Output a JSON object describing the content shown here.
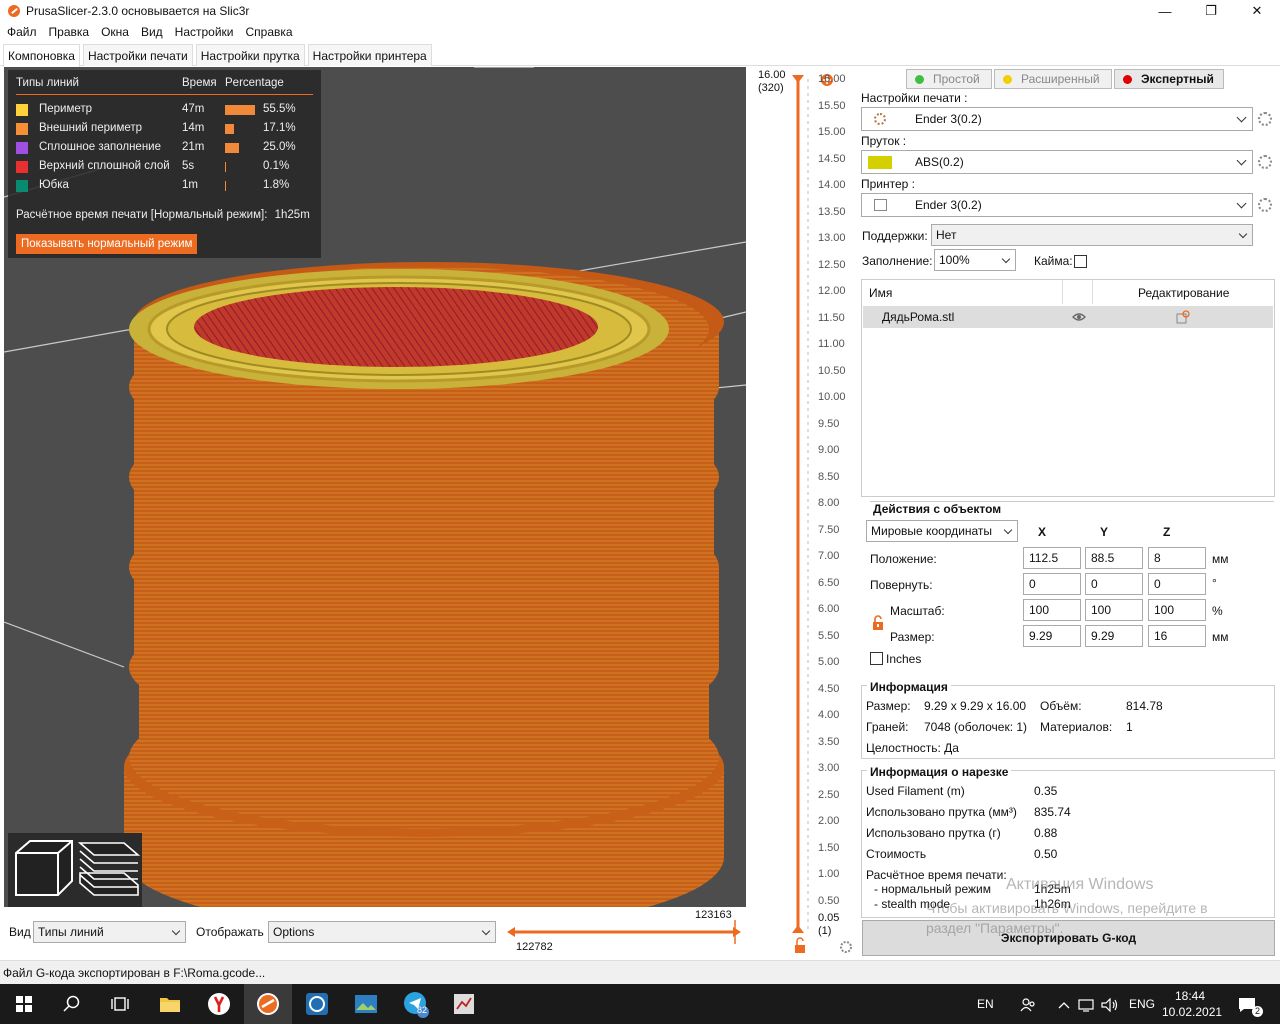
{
  "window": {
    "title": "PrusaSlicer-2.3.0 основывается на Slic3r",
    "minimize": "—",
    "maximize": "❐",
    "close": "✕"
  },
  "menu": [
    "Файл",
    "Правка",
    "Окна",
    "Вид",
    "Настройки",
    "Справка"
  ],
  "tabs": [
    "Компоновка",
    "Настройки печати",
    "Настройки прутка",
    "Настройки принтера"
  ],
  "legend": {
    "headers": [
      "Типы линий",
      "Время",
      "Percentage"
    ],
    "rows": [
      {
        "label": "Периметр",
        "time": "47m",
        "percent": "55.5%",
        "fraction": 0.555,
        "color": "#ffd23c"
      },
      {
        "label": "Внешний периметр",
        "time": "14m",
        "percent": "17.1%",
        "fraction": 0.171,
        "color": "#f59038"
      },
      {
        "label": "Сплошное заполнение",
        "time": "21m",
        "percent": "25.0%",
        "fraction": 0.25,
        "color": "#a050e0"
      },
      {
        "label": "Верхний сплошной слой",
        "time": "5s",
        "percent": "0.1%",
        "fraction": 0.001,
        "color": "#e83030"
      },
      {
        "label": "Юбка",
        "time": "1m",
        "percent": "1.8%",
        "fraction": 0.018,
        "color": "#0a8a70"
      }
    ],
    "estimated": "Расчётное время печати [Нормальный режим]:",
    "estimated_value": "1h25m",
    "show_mode_button": "Показывать нормальный режим"
  },
  "vslider": {
    "top_value": "16.00",
    "top_layer": "(320)",
    "bottom_value": "0.05",
    "bottom_layer": "(1)",
    "ticks": [
      "16.00",
      "15.50",
      "15.00",
      "14.50",
      "14.00",
      "13.50",
      "13.00",
      "12.50",
      "12.00",
      "11.50",
      "11.00",
      "10.50",
      "10.00",
      "9.50",
      "9.00",
      "8.50",
      "8.00",
      "7.50",
      "7.00",
      "6.50",
      "6.00",
      "5.50",
      "5.00",
      "4.50",
      "4.00",
      "3.50",
      "3.00",
      "2.50",
      "2.00",
      "1.50",
      "1.00",
      "0.50"
    ]
  },
  "bottom": {
    "view_label": "Вид",
    "view_value": "Типы линий",
    "show_label": "Отображать",
    "show_value": "Options",
    "hslider_left": "122782",
    "hslider_right": "123163"
  },
  "modes": [
    {
      "label": "Простой",
      "color": "#3fbf3f",
      "active": false
    },
    {
      "label": "Расширенный",
      "color": "#f0d000",
      "active": false
    },
    {
      "label": "Экспертный",
      "color": "#e00000",
      "active": true
    }
  ],
  "presets": {
    "print_label": "Настройки печати :",
    "print_value": "Ender 3(0.2)",
    "filament_label": "Пруток :",
    "filament_value": "ABS(0.2)",
    "filament_color": "#d4d000",
    "printer_label": "Принтер :",
    "printer_value": "Ender 3(0.2)",
    "supports_label": "Поддержки:",
    "supports_value": "Нет",
    "infill_label": "Заполнение:",
    "infill_value": "100%",
    "brim_label": "Кайма:"
  },
  "objects": {
    "col_name": "Имя",
    "col_edit": "Редактирование",
    "row_name": "ДядьРома.stl"
  },
  "manipulation": {
    "title": "Действия с объектом",
    "coords": "Мировые координаты",
    "x": "X",
    "y": "Y",
    "z": "Z",
    "position_label": "Положение:",
    "position": [
      "112.5",
      "88.5",
      "8"
    ],
    "position_unit": "мм",
    "rotate_label": "Повернуть:",
    "rotate": [
      "0",
      "0",
      "0"
    ],
    "rotate_unit": "°",
    "scale_label": "Масштаб:",
    "scale": [
      "100",
      "100",
      "100"
    ],
    "scale_unit": "%",
    "size_label": "Размер:",
    "size": [
      "9.29",
      "9.29",
      "16"
    ],
    "size_unit": "мм",
    "inches": "Inches"
  },
  "info": {
    "title": "Информация",
    "size_label": "Размер:",
    "size_value": "9.29 x 9.29 x 16.00",
    "volume_label": "Объём:",
    "volume_value": "814.78",
    "facets_label": "Граней:",
    "facets_value": "7048 (оболочек: 1)",
    "materials_label": "Материалов:",
    "materials_value": "1",
    "manifold": "Целостность: Да"
  },
  "slice_info": {
    "title": "Информация о нарезке",
    "rows": [
      {
        "label": "Used Filament (m)",
        "value": "0.35"
      },
      {
        "label": "Использовано прутка (мм³)",
        "value": "835.74"
      },
      {
        "label": "Использовано прутка (г)",
        "value": "0.88"
      },
      {
        "label": "Стоимость",
        "value": "0.50"
      }
    ],
    "est_label": "Расчётное время печати:",
    "normal_label": "- нормальный режим",
    "normal_value": "1h25m",
    "stealth_label": "- stealth mode",
    "stealth_value": "1h26m"
  },
  "export_button": "Экспортировать G-код",
  "watermark": {
    "line1": "Активация Windows",
    "line2": "Чтобы активировать Windows, перейдите в",
    "line3": "раздел \"Параметры\"."
  },
  "status": "Файл G-кода экспортирован в F:\\Roma.gcode...",
  "taskbar": {
    "lang_en": "EN",
    "lang": "ENG",
    "time": "18:44",
    "date": "10.02.2021",
    "badge": "82",
    "notif": "2"
  }
}
